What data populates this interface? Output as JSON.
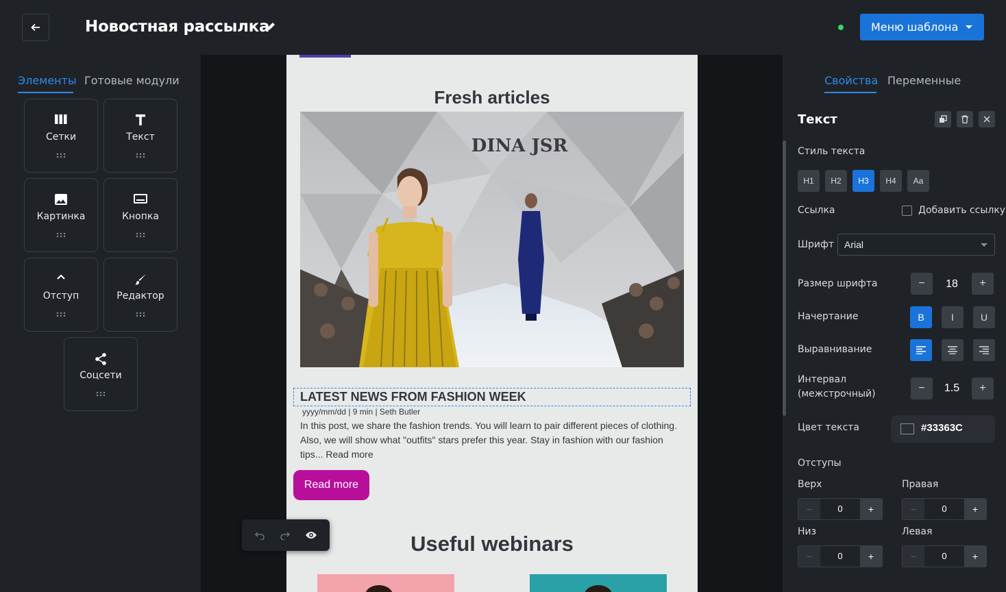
{
  "header": {
    "title": "Новостная рассылка",
    "menu_button": "Меню шаблона",
    "status_color": "#3ad36b"
  },
  "left_panel": {
    "tabs": [
      {
        "label": "Элементы",
        "active": true
      },
      {
        "label": "Готовые модули",
        "active": false
      }
    ],
    "tiles": [
      {
        "label": "Сетки",
        "icon": "columns-icon"
      },
      {
        "label": "Текст",
        "icon": "text-icon"
      },
      {
        "label": "Картинка",
        "icon": "image-icon"
      },
      {
        "label": "Кнопка",
        "icon": "button-icon"
      },
      {
        "label": "Отступ",
        "icon": "spacer-icon"
      },
      {
        "label": "Редактор",
        "icon": "brush-icon"
      },
      {
        "label": "Соцсети",
        "icon": "share-icon"
      }
    ]
  },
  "email": {
    "section1_title": "Fresh articles",
    "photo_sign": "DINA JSR",
    "news_heading": "LATEST NEWS FROM FASHION WEEK",
    "meta": "yyyy/mm/dd | 9 min | Seth Butler",
    "body_line1": "In this post, we share the fashion trends. You will learn to pair different pieces of clothing.",
    "body_line2": "Also, we will show what \"outfits\" stars prefer this year. Stay in fashion with our fashion",
    "body_line3": "tips... Read more",
    "button_label": "Read more",
    "section2_title": "Useful webinars"
  },
  "right_panel": {
    "tabs": [
      {
        "label": "Свойства",
        "active": true
      },
      {
        "label": "Переменные",
        "active": false
      }
    ],
    "title": "Текст",
    "text_style_label": "Стиль текста",
    "heading_options": [
      "H1",
      "H2",
      "H3",
      "H4",
      "Aa"
    ],
    "heading_selected": "H3",
    "link_label": "Ссылка",
    "add_link_label": "Добавить ссылку",
    "font_label": "Шрифт",
    "font_value": "Arial",
    "font_size_label": "Размер шрифта",
    "font_size_value": "18",
    "style_label": "Начертание",
    "style_bold": "B",
    "style_italic": "I",
    "style_underline": "U",
    "align_label": "Выравнивание",
    "interval_label_1": "Интервал",
    "interval_label_2": "(межстрочный)",
    "interval_value": "1.5",
    "color_label": "Цвет текста",
    "color_value": "#33363C",
    "padding_label": "Отступы",
    "top_label": "Верх",
    "right_label": "Правая",
    "bottom_label": "Низ",
    "left_label": "Левая",
    "top_value": "0",
    "right_value": "0",
    "bottom_value": "0",
    "left_value": "0",
    "minus": "−",
    "plus": "+"
  }
}
